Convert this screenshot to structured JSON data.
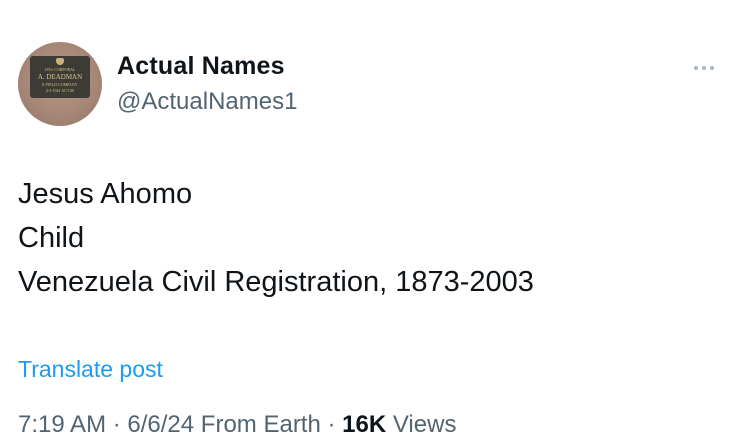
{
  "author": {
    "display_name": "Actual Names",
    "handle": "@ActualNames1",
    "avatar": {
      "plaque_lines": [
        "1STx CORPORAL",
        "A. DEADMAN",
        "E FIELD COMPANY",
        "4-2-1941 ACT 60"
      ]
    }
  },
  "post": {
    "lines": [
      "Jesus Ahomo",
      "Child",
      "Venezuela Civil Registration, 1873-2003"
    ],
    "translate_label": "Translate post"
  },
  "meta": {
    "time": "7:19 AM",
    "separator": " · ",
    "date": "6/6/24",
    "source": "From Earth",
    "views_count": "16K",
    "views_label": "Views"
  },
  "colors": {
    "link": "#1d9bf0",
    "secondary_text": "#536471",
    "primary_text": "#0f1419"
  },
  "icons": {
    "more": "more-horizontal-icon"
  }
}
